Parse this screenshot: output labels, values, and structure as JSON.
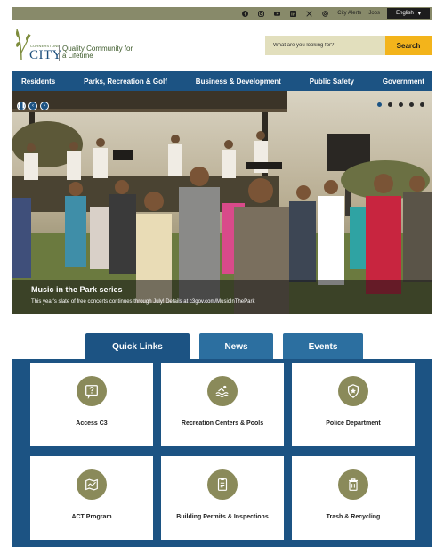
{
  "utility": {
    "icons": [
      "facebook-icon",
      "instagram-icon",
      "youtube-icon",
      "linkedin-icon",
      "x-icon",
      "threads-icon"
    ],
    "city_alerts": "City Alerts",
    "jobs": "Jobs",
    "language": "English",
    "lang_arrow": "▾"
  },
  "header": {
    "logo_small": "CORNERSTONE",
    "logo_city": "CITY",
    "logo_tagline": "Quality Community for a Lifetime",
    "search_placeholder": "What are you looking for?",
    "search_button": "Search"
  },
  "nav": {
    "items": [
      "Residents",
      "Parks, Recreation & Golf",
      "Business & Development",
      "Public Safety",
      "Government"
    ]
  },
  "hero": {
    "pause": "❚❚",
    "prev": "‹",
    "next": "›",
    "slide_count": 5,
    "active_slide": 1,
    "title": "Music in the Park series",
    "text": "This year's slate of free concerts continues through July! Details at c3gov.com/MusicInThePark"
  },
  "tabs": [
    "Quick Links",
    "News",
    "Events"
  ],
  "quick_links": [
    {
      "label": "Access C3",
      "icon": "question-icon"
    },
    {
      "label": "Recreation Centers & Pools",
      "icon": "pool-icon"
    },
    {
      "label": "Police Department",
      "icon": "police-badge-icon"
    },
    {
      "label": "ACT Program",
      "icon": "map-icon"
    },
    {
      "label": "Building Permits & Inspections",
      "icon": "permit-document-icon"
    },
    {
      "label": "Trash & Recycling",
      "icon": "trash-can-icon"
    }
  ],
  "colors": {
    "nav_blue": "#1c5383",
    "utility_olive": "#888a6a",
    "search_gold": "#f3b41b",
    "icon_olive": "#8a8a5a"
  }
}
